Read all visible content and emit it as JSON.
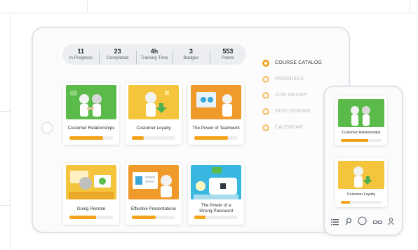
{
  "stats": [
    {
      "value": "11",
      "label": "In Progress"
    },
    {
      "value": "23",
      "label": "Completed"
    },
    {
      "value": "4h",
      "label": "Training Time"
    },
    {
      "value": "3",
      "label": "Badges"
    },
    {
      "value": "553",
      "label": "Points"
    }
  ],
  "courses": [
    {
      "title": "Customer Relationships",
      "progress": 0.78
    },
    {
      "title": "Customer Loyalty",
      "progress": 0.28
    },
    {
      "title": "The Power of Teamwork",
      "progress": 0.78
    },
    {
      "title": "Going Remote",
      "progress": 0.62
    },
    {
      "title": "Effective Presentations",
      "progress": 0.55
    },
    {
      "title": "The Power of a Strong Password",
      "progress": 0.25
    }
  ],
  "menu": [
    {
      "label": "COURSE CATALOG",
      "icon": "catalog-icon",
      "active": true
    },
    {
      "label": "PROGRESS",
      "icon": "progress-icon",
      "active": false
    },
    {
      "label": "JOIN GROUP",
      "icon": "group-icon",
      "active": false
    },
    {
      "label": "DISCUSSIONS",
      "icon": "discussion-icon",
      "active": false
    },
    {
      "label": "CALENDAR",
      "icon": "calendar-icon",
      "active": false
    }
  ],
  "phone": {
    "courses": [
      {
        "title": "Customer Relationships",
        "progress": 0.68
      },
      {
        "title": "Customer Loyalty",
        "progress": 0.22
      }
    ],
    "nav_icons": [
      "list-icon",
      "search-icon",
      "home-icon",
      "glasses-icon",
      "user-icon"
    ]
  },
  "colors": {
    "accent": "#f5a31a",
    "green": "#5bbb4a",
    "orange": "#f2a531",
    "blue": "#39b7e0",
    "text": "#2b2f36"
  }
}
